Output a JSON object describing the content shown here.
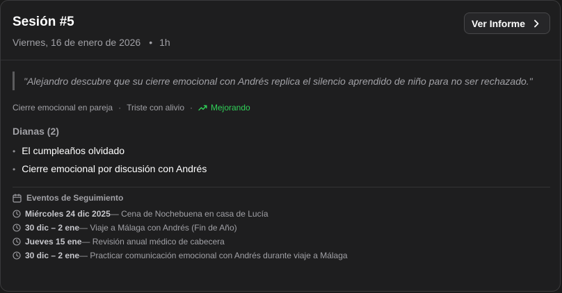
{
  "session": {
    "title": "Sesión #5",
    "date": "Viernes, 16 de enero de 2026",
    "duration": "1h",
    "separator": "•"
  },
  "report_button": {
    "label": "Ver Informe",
    "icon": "chevron-right-icon"
  },
  "quote": "\"Alejandro descubre que su cierre emocional con Andrés replica el silencio aprendido de niño para no ser rechazado.\"",
  "tags": {
    "topic": "Cierre emocional en pareja",
    "mood": "Triste con alivio",
    "progress": "Mejorando",
    "separator": "·",
    "progress_color": "#30d158",
    "progress_icon": "trending-up-icon"
  },
  "dianas": {
    "heading": "Dianas (2)",
    "items": [
      "El cumpleaños olvidado",
      "Cierre emocional por discusión con Andrés"
    ]
  },
  "events": {
    "heading": "Eventos de Seguimiento",
    "heading_icon": "calendar-icon",
    "item_icon": "clock-icon",
    "items": [
      {
        "date": "Miércoles 24 dic 2025",
        "text": " — Cena de Nochebuena en casa de Lucía"
      },
      {
        "date": "30 dic – 2 ene",
        "text": " — Viaje a Málaga con Andrés (Fin de Año)"
      },
      {
        "date": "Jueves 15 ene",
        "text": " — Revisión anual médico de cabecera"
      },
      {
        "date": "30 dic – 2 ene",
        "text": " — Practicar comunicación emocional con Andrés durante viaje a Málaga"
      }
    ]
  }
}
